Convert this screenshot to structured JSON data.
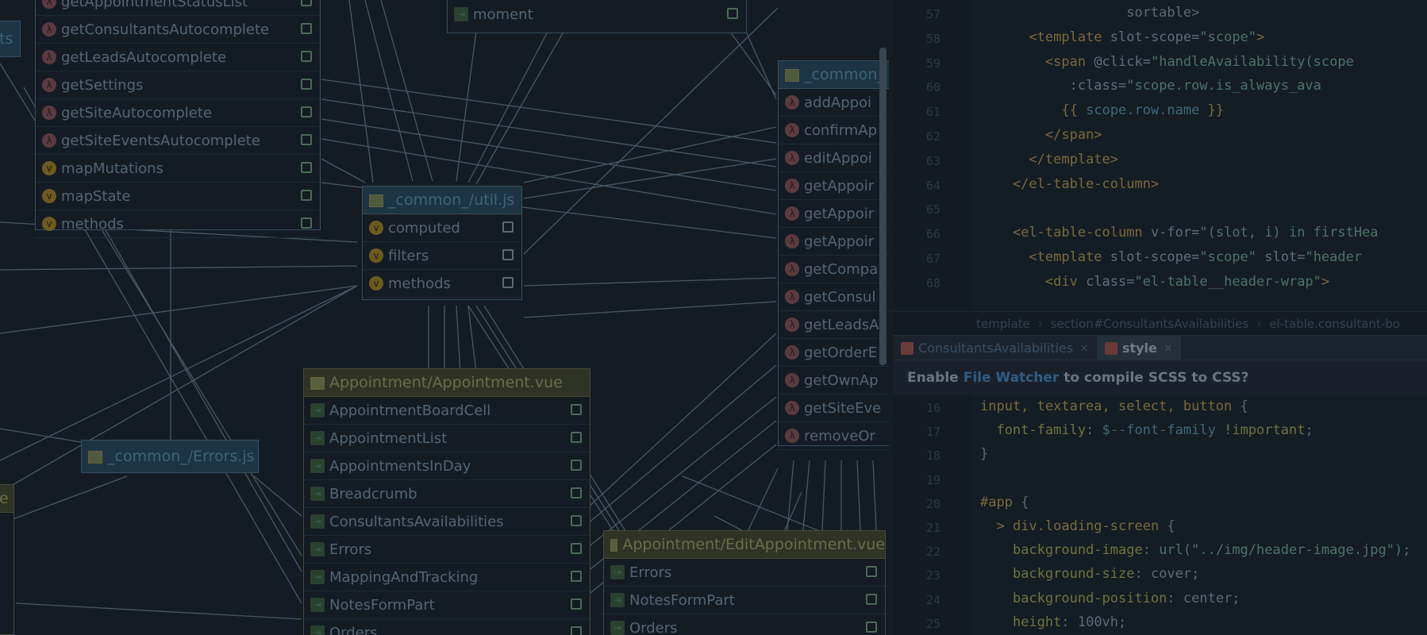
{
  "diagram": {
    "nodes": [
      {
        "id": "store-actions",
        "title": "",
        "members": [
          {
            "icon": "l",
            "label": "getAppointmentStatusList"
          },
          {
            "icon": "l",
            "label": "getConsultantsAutocomplete"
          },
          {
            "icon": "l",
            "label": "getLeadsAutocomplete"
          },
          {
            "icon": "l",
            "label": "getSettings"
          },
          {
            "icon": "l",
            "label": "getSiteAutocomplete"
          },
          {
            "icon": "l",
            "label": "getSiteEventsAutocomplete"
          },
          {
            "icon": "v",
            "label": "mapMutations"
          },
          {
            "icon": "v",
            "label": "mapState"
          },
          {
            "icon": "v",
            "label": "methods"
          }
        ]
      },
      {
        "id": "moment",
        "title": "",
        "members": [
          {
            "icon": "c",
            "label": "moment"
          }
        ]
      },
      {
        "id": "util",
        "title": "_common_/util.js",
        "members": [
          {
            "icon": "v",
            "label": "computed"
          },
          {
            "icon": "v",
            "label": "filters"
          },
          {
            "icon": "v",
            "label": "methods"
          }
        ]
      },
      {
        "id": "common-api",
        "title": "_common_",
        "members": [
          {
            "icon": "l",
            "label": "addAppoi"
          },
          {
            "icon": "l",
            "label": "confirmAp"
          },
          {
            "icon": "l",
            "label": "editAppoi"
          },
          {
            "icon": "l",
            "label": "getAppoir"
          },
          {
            "icon": "l",
            "label": "getAppoir"
          },
          {
            "icon": "l",
            "label": "getAppoir"
          },
          {
            "icon": "l",
            "label": "getCompa"
          },
          {
            "icon": "l",
            "label": "getConsul"
          },
          {
            "icon": "l",
            "label": "getLeadsA"
          },
          {
            "icon": "l",
            "label": "getOrderE"
          },
          {
            "icon": "l",
            "label": "getOwnAp"
          },
          {
            "icon": "l",
            "label": "getSiteEve"
          },
          {
            "icon": "l",
            "label": "removeOr"
          }
        ]
      },
      {
        "id": "errors",
        "title": "_common_/Errors.js",
        "members": []
      },
      {
        "id": "appointment",
        "title": "Appointment/Appointment.vue",
        "members": [
          {
            "icon": "c",
            "label": "AppointmentBoardCell"
          },
          {
            "icon": "c",
            "label": "AppointmentList"
          },
          {
            "icon": "c",
            "label": "AppointmentsInDay"
          },
          {
            "icon": "c",
            "label": "Breadcrumb"
          },
          {
            "icon": "c",
            "label": "ConsultantsAvailabilities"
          },
          {
            "icon": "c",
            "label": "Errors"
          },
          {
            "icon": "c",
            "label": "MappingAndTracking"
          },
          {
            "icon": "c",
            "label": "NotesFormPart"
          },
          {
            "icon": "c",
            "label": "Orders"
          }
        ]
      },
      {
        "id": "edit-appointment",
        "title": "Appointment/EditAppointment.vue",
        "members": [
          {
            "icon": "c",
            "label": "Errors"
          },
          {
            "icon": "c",
            "label": "NotesFormPart"
          },
          {
            "icon": "c",
            "label": "Orders"
          }
        ]
      },
      {
        "id": "left-stub-top",
        "title": "ts",
        "members": []
      },
      {
        "id": "left-stub-bottom",
        "title": "e",
        "members": []
      }
    ]
  },
  "editor": {
    "top_lines": [
      {
        "n": "57",
        "tokens": [
          [
            "t-plain",
            "                  sortable>"
          ]
        ]
      },
      {
        "n": "58",
        "tokens": [
          [
            "t-plain",
            "      "
          ],
          [
            "t-tag",
            "<template "
          ],
          [
            "t-attr",
            "slot-scope="
          ],
          [
            "t-str",
            "\"scope\""
          ],
          [
            "t-tag",
            ">"
          ]
        ]
      },
      {
        "n": "59",
        "tokens": [
          [
            "t-plain",
            "        "
          ],
          [
            "t-tag",
            "<span "
          ],
          [
            "t-attr",
            "@click="
          ],
          [
            "t-str",
            "\"handleAvailability(scope"
          ]
        ]
      },
      {
        "n": "60",
        "tokens": [
          [
            "t-plain",
            "           "
          ],
          [
            "t-attr",
            ":class="
          ],
          [
            "t-str",
            "\"scope.row.is_always_ava"
          ]
        ]
      },
      {
        "n": "61",
        "tokens": [
          [
            "t-plain",
            "          "
          ],
          [
            "t-tag",
            "{{ "
          ],
          [
            "t-var",
            "scope.row.name"
          ],
          [
            "t-tag",
            " }}"
          ]
        ]
      },
      {
        "n": "62",
        "tokens": [
          [
            "t-plain",
            "        "
          ],
          [
            "t-tag",
            "</span>"
          ]
        ]
      },
      {
        "n": "63",
        "tokens": [
          [
            "t-plain",
            "      "
          ],
          [
            "t-tag",
            "</template>"
          ]
        ]
      },
      {
        "n": "64",
        "tokens": [
          [
            "t-plain",
            "    "
          ],
          [
            "t-tag",
            "</el-table-column>"
          ]
        ]
      },
      {
        "n": "65",
        "tokens": [
          [
            "t-plain",
            ""
          ]
        ]
      },
      {
        "n": "66",
        "tokens": [
          [
            "t-plain",
            "    "
          ],
          [
            "t-tag",
            "<el-table-column "
          ],
          [
            "t-attr",
            "v-for="
          ],
          [
            "t-str",
            "\"(slot, i) in firstHea"
          ]
        ]
      },
      {
        "n": "67",
        "tokens": [
          [
            "t-plain",
            "      "
          ],
          [
            "t-tag",
            "<template "
          ],
          [
            "t-attr",
            "slot-scope="
          ],
          [
            "t-str",
            "\"scope\""
          ],
          [
            "t-attr",
            " slot="
          ],
          [
            "t-str",
            "\"header"
          ]
        ]
      },
      {
        "n": "68",
        "tokens": [
          [
            "t-plain",
            "        "
          ],
          [
            "t-tag",
            "<div "
          ],
          [
            "t-attr",
            "class="
          ],
          [
            "t-str",
            "\"el-table__header-wrap\""
          ],
          [
            "t-tag",
            ">"
          ]
        ]
      }
    ],
    "breadcrumb": [
      "template",
      "section#ConsultantsAvailabilities",
      "el-table.consultant-bo"
    ],
    "tabs": [
      {
        "label": "ConsultantsAvailabilities",
        "close": "×",
        "active": false
      },
      {
        "label": "style",
        "close": "×",
        "active": true
      }
    ],
    "banner": {
      "before": "Enable",
      "link": "File Watcher",
      "after": "to compile SCSS to CSS?"
    },
    "bottom_lines": [
      {
        "n": "16",
        "tokens": [
          [
            "t-tag",
            "input, textarea, select, button "
          ],
          [
            "t-plain",
            "{"
          ]
        ]
      },
      {
        "n": "17",
        "tokens": [
          [
            "t-plain",
            "  "
          ],
          [
            "t-prop",
            "font-family"
          ],
          [
            "t-plain",
            ": "
          ],
          [
            "t-var",
            "$--font-family "
          ],
          [
            "t-prop",
            "!important"
          ],
          [
            "t-plain",
            ";"
          ]
        ]
      },
      {
        "n": "18",
        "tokens": [
          [
            "t-plain",
            "}"
          ]
        ]
      },
      {
        "n": "19",
        "tokens": [
          [
            "t-plain",
            ""
          ]
        ]
      },
      {
        "n": "20",
        "tokens": [
          [
            "t-tag",
            "#app "
          ],
          [
            "t-plain",
            "{"
          ]
        ]
      },
      {
        "n": "21",
        "tokens": [
          [
            "t-plain",
            "  "
          ],
          [
            "t-tag",
            "> div.loading-screen "
          ],
          [
            "t-plain",
            "{"
          ]
        ]
      },
      {
        "n": "22",
        "tokens": [
          [
            "t-plain",
            "    "
          ],
          [
            "t-prop",
            "background-image"
          ],
          [
            "t-plain",
            ": "
          ],
          [
            "t-str",
            "url(\"../img/header-image.jpg\")"
          ],
          [
            "t-plain",
            ";"
          ]
        ]
      },
      {
        "n": "23",
        "tokens": [
          [
            "t-plain",
            "    "
          ],
          [
            "t-prop",
            "background-size"
          ],
          [
            "t-plain",
            ": cover;"
          ]
        ]
      },
      {
        "n": "24",
        "tokens": [
          [
            "t-plain",
            "    "
          ],
          [
            "t-prop",
            "background-position"
          ],
          [
            "t-plain",
            ": center;"
          ]
        ]
      },
      {
        "n": "25",
        "tokens": [
          [
            "t-plain",
            "    "
          ],
          [
            "t-prop",
            "height"
          ],
          [
            "t-plain",
            ": 100vh;"
          ]
        ]
      }
    ]
  }
}
